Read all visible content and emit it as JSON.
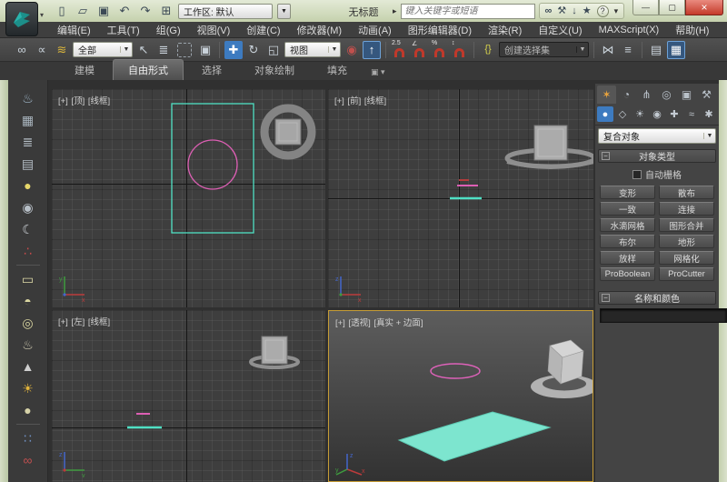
{
  "window": {
    "title": "无标题",
    "workspace_label": "工作区: 默认",
    "search_placeholder": "键入关键字或短语"
  },
  "menu": {
    "items": [
      "编辑(E)",
      "工具(T)",
      "组(G)",
      "视图(V)",
      "创建(C)",
      "修改器(M)",
      "动画(A)",
      "图形编辑器(D)",
      "渲染(R)",
      "自定义(U)",
      "MAXScript(X)",
      "帮助(H)"
    ]
  },
  "toolbar": {
    "selection_filter": "全部",
    "coord_system": "视图",
    "named_sets": "创建选择集",
    "snap_labels": {
      "snap": "2.5",
      "angle": "∠",
      "percent": "%",
      "spinner": "↕"
    }
  },
  "ribbon": {
    "tabs": [
      "建模",
      "自由形式",
      "选择",
      "对象绘制",
      "填充"
    ],
    "active_tab": "自由形式"
  },
  "viewports": {
    "top": {
      "plus": "[+]",
      "view": "[顶]",
      "shading": "[线框]"
    },
    "front": {
      "plus": "[+]",
      "view": "[前]",
      "shading": "[线框]"
    },
    "left": {
      "plus": "[+]",
      "view": "[左]",
      "shading": "[线框]"
    },
    "perspective": {
      "plus": "[+]",
      "view": "[透视]",
      "shading": "[真实 + 边面]"
    }
  },
  "command_panel": {
    "category_dropdown": "复合对象",
    "object_type": {
      "title": "对象类型",
      "autogrid_label": "自动栅格",
      "buttons": [
        "变形",
        "散布",
        "一致",
        "连接",
        "水滴网格",
        "图形合并",
        "布尔",
        "地形",
        "放样",
        "网格化",
        "ProBoolean",
        "ProCutter"
      ]
    },
    "name_color": {
      "title": "名称和颜色"
    }
  },
  "icons": {
    "new": "▯",
    "open": "▱",
    "save": "▣",
    "undo": "↶",
    "redo": "↷",
    "fetch": "⊞",
    "dropdown_arrow": "▼",
    "search_go": "▸",
    "binoculars": "∞",
    "wrench": "⚒",
    "download": "↓",
    "favorites": "★",
    "help": "?",
    "minimize": "—",
    "maximize": "▢",
    "close": "×",
    "link": "∞",
    "unlink": "∝",
    "bind_spacewarp": "≋",
    "select": "↖",
    "select_by_name": "≣",
    "region": "▢",
    "window_sel": "▣",
    "move": "✚",
    "rotate": "↻",
    "scale": "◱",
    "pivot": "◉",
    "manipulate": "↑",
    "edit_sets": "{}",
    "mirror": "⋈",
    "align": "≡",
    "layers": "▤",
    "sheets": "▤",
    "ribbon_toggle": "▦",
    "tab_create": "✶",
    "tab_modify": "◔",
    "tab_hierarchy": "⋔",
    "tab_motion": "◎",
    "tab_display": "▣",
    "tab_utils": "⚒",
    "cat_geometry": "●",
    "cat_shapes": "◇",
    "cat_lights": "☀",
    "cat_cameras": "◉",
    "cat_helpers": "✚",
    "cat_warps": "≈",
    "cat_systems": "✱",
    "lt_teapot": "♨",
    "lt_frame": "▦",
    "lt_list": "≣",
    "lt_table": "▤",
    "lt_bulb": "●",
    "lt_camera": "◉",
    "lt_moon": "☾",
    "lt_particles": "∴",
    "lt_plane": "▭",
    "lt_dome": "◓",
    "lt_circle": "◎",
    "lt_teapot2": "♨",
    "lt_cone": "▲",
    "lt_sun": "☀",
    "lt_sphere": "●",
    "lt_grid": "∷",
    "lt_bones": "∞"
  },
  "colors": {
    "accent_blue": "#3d7bc0",
    "object_teal": "#74e4cd",
    "object_pink": "#dd5fb4",
    "name_swatch": "#d5358f",
    "active_viewport_border": "#c69c35"
  }
}
